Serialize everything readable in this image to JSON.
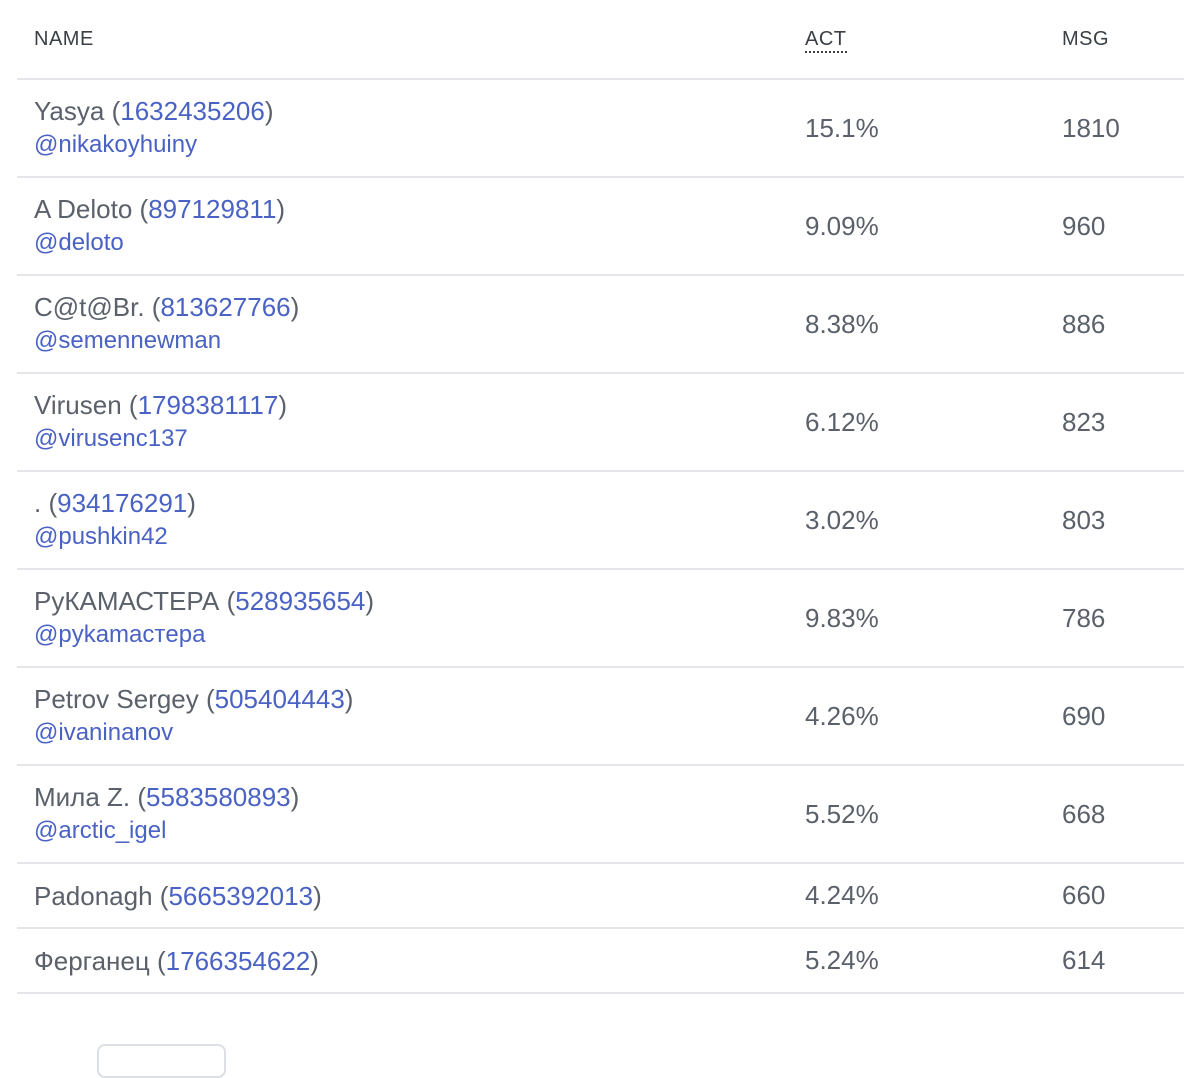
{
  "table": {
    "headers": {
      "name": "NAME",
      "act": "ACT",
      "msg": "MSG"
    },
    "rows": [
      {
        "display_name": "Yasya",
        "user_id": "1632435206",
        "username": "@nikakoyhuiny",
        "act": "15.1%",
        "msg": "1810"
      },
      {
        "display_name": "A Deloto",
        "user_id": "897129811",
        "username": "@deloto",
        "act": "9.09%",
        "msg": "960"
      },
      {
        "display_name": "C@t@Br.",
        "user_id": "813627766",
        "username": "@semennewman",
        "act": "8.38%",
        "msg": "886"
      },
      {
        "display_name": "Virusen",
        "user_id": "1798381117",
        "username": "@virusenc137",
        "act": "6.12%",
        "msg": "823"
      },
      {
        "display_name": ".",
        "user_id": "934176291",
        "username": "@pushkin42",
        "act": "3.02%",
        "msg": "803"
      },
      {
        "display_name": "РуКАМАСТЕРА",
        "user_id": "528935654",
        "username": "@pykamacтepa",
        "act": "9.83%",
        "msg": "786"
      },
      {
        "display_name": "Petrov Sergey",
        "user_id": "505404443",
        "username": "@ivaninanov",
        "act": "4.26%",
        "msg": "690"
      },
      {
        "display_name": "Мила Z.",
        "user_id": "5583580893",
        "username": "@arctic_igel",
        "act": "5.52%",
        "msg": "668"
      },
      {
        "display_name": "Padonagh",
        "user_id": "5665392013",
        "username": "",
        "act": "4.24%",
        "msg": "660"
      },
      {
        "display_name": "Ферганец",
        "user_id": "1766354622",
        "username": "",
        "act": "5.24%",
        "msg": "614"
      }
    ]
  }
}
